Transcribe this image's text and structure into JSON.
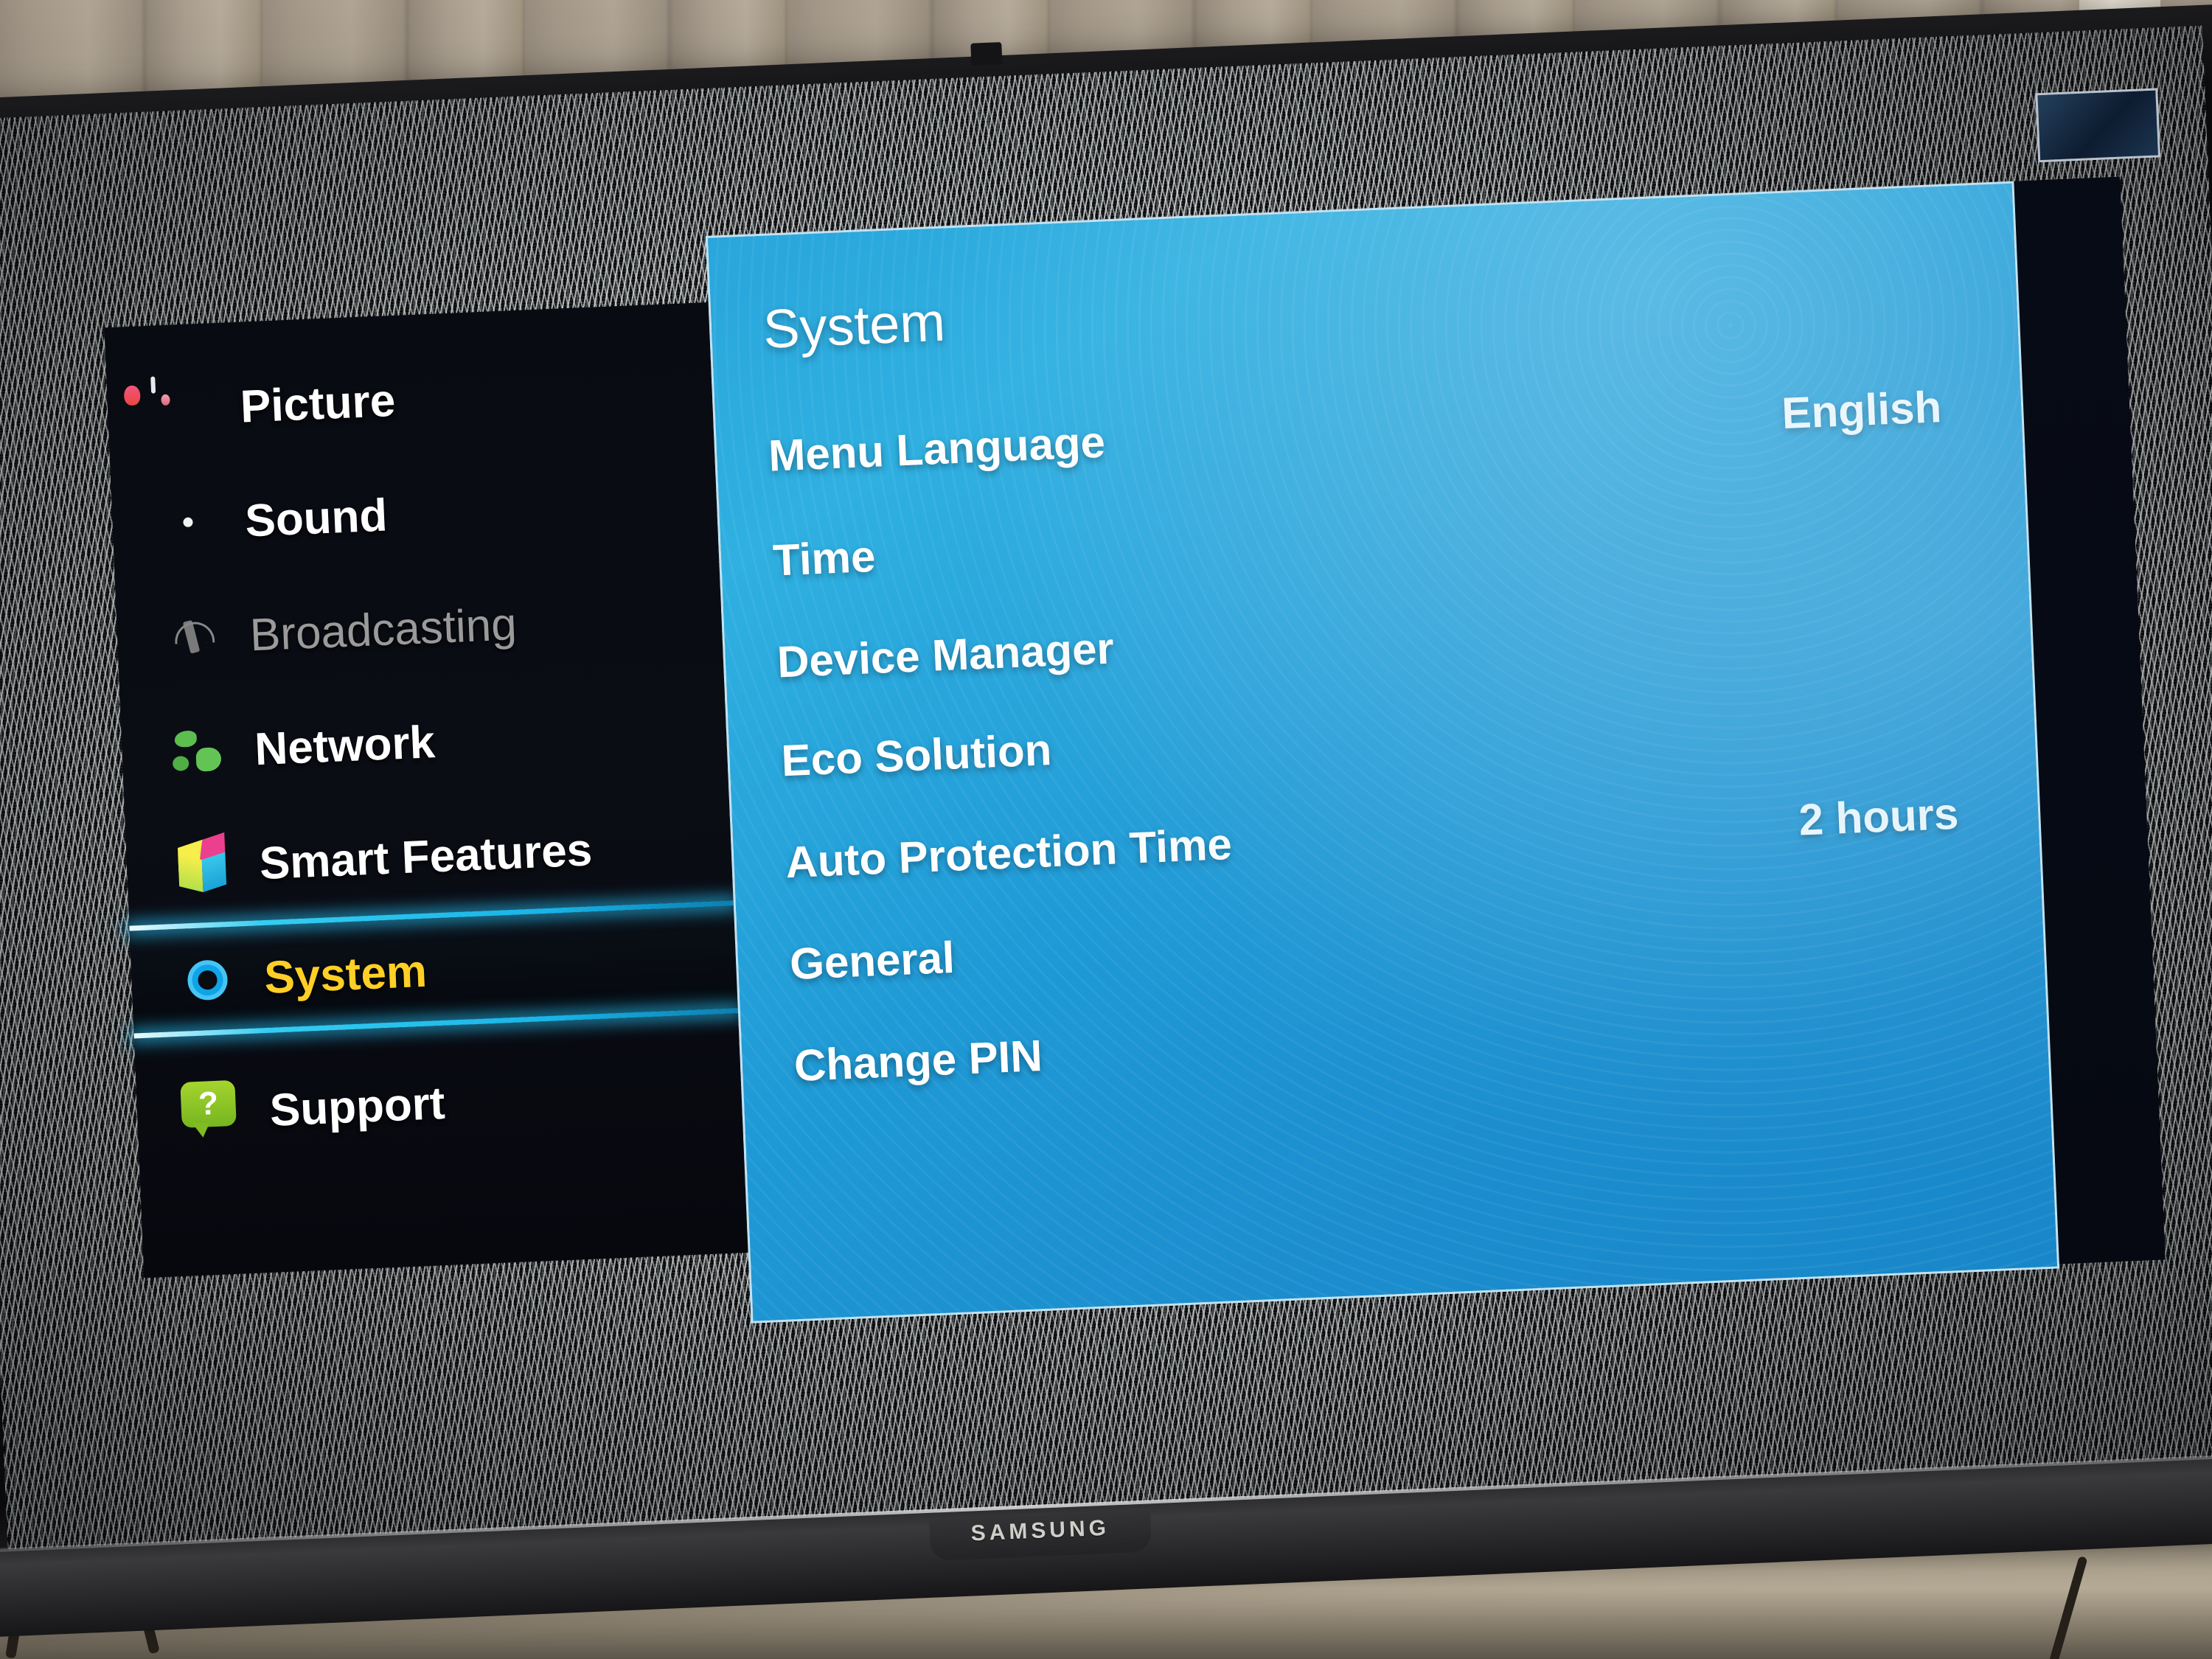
{
  "scene": {
    "device_brand": "SAMSUNG",
    "background_signal": "static-noise"
  },
  "osd": {
    "sidebar": {
      "items": [
        {
          "label": "Picture",
          "icon": "picture-icon",
          "state": "normal"
        },
        {
          "label": "Sound",
          "icon": "speaker-icon",
          "state": "normal"
        },
        {
          "label": "Broadcasting",
          "icon": "satellite-dish-icon",
          "state": "disabled"
        },
        {
          "label": "Network",
          "icon": "globe-icon",
          "state": "normal"
        },
        {
          "label": "Smart Features",
          "icon": "cube-icon",
          "state": "normal"
        },
        {
          "label": "System",
          "icon": "gear-icon",
          "state": "selected"
        },
        {
          "label": "Support",
          "icon": "question-bubble-icon",
          "state": "normal"
        }
      ]
    },
    "panel": {
      "title": "System",
      "rows": [
        {
          "label": "Menu Language",
          "value": "English"
        },
        {
          "label": "Time",
          "value": ""
        },
        {
          "label": "Device Manager",
          "value": ""
        },
        {
          "label": "Eco Solution",
          "value": ""
        },
        {
          "label": "Auto Protection Time",
          "value": "2 hours"
        },
        {
          "label": "General",
          "value": ""
        },
        {
          "label": "Change PIN",
          "value": ""
        }
      ]
    }
  },
  "colors": {
    "panel_blue": "#1f9bd8",
    "panel_blue_light": "#3fb8e0",
    "sidebar_dark": "#0b0d15",
    "selected_text": "#ffcf26",
    "highlight_line": "#35cdf2",
    "disabled_text": "#9a9a9a"
  }
}
